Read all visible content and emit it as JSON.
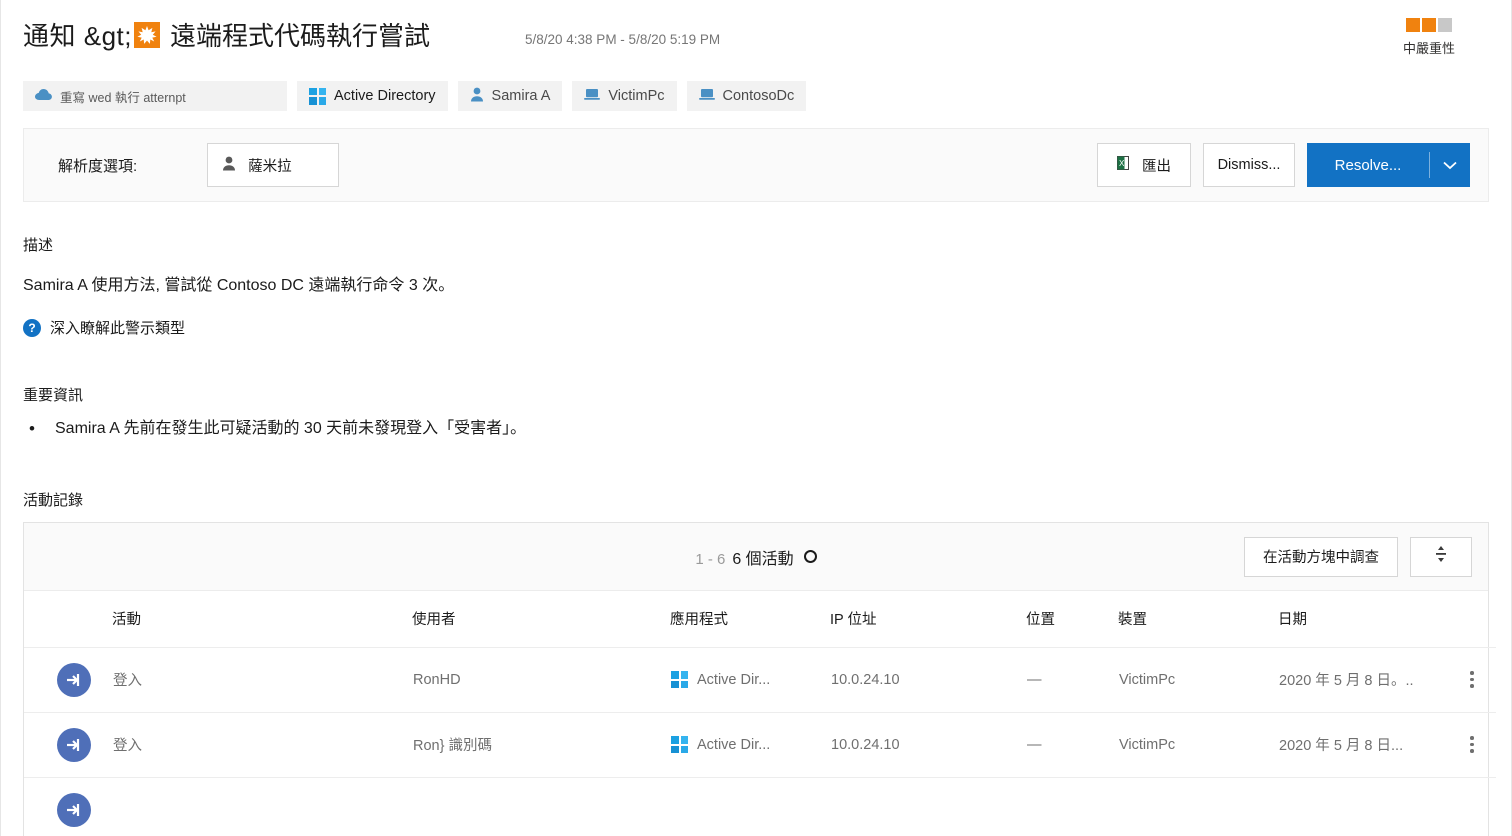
{
  "header": {
    "breadcrumb_prefix": "通知 &gt;",
    "title": "遠端程式代碼執行嘗試",
    "time_range": "5/8/20 4:38 PM - 5/8/20 5:19 PM",
    "severity_label": "中嚴重性",
    "severity_color": "#f0820f",
    "severity_filled": 2,
    "severity_total": 3,
    "alert_icon": "alert-starburst-icon"
  },
  "entities": [
    {
      "label": "重寫 wed 執行 atternpt",
      "icon": "alert-cloud-icon",
      "wide": true
    },
    {
      "label": "Active Directory",
      "icon": "windows-logo-icon",
      "wide": false
    },
    {
      "label": "Samira A",
      "icon": "user-icon",
      "wide": false
    },
    {
      "label": "VictimPc",
      "icon": "device-icon",
      "wide": false
    },
    {
      "label": "ContosoDc",
      "icon": "device-icon",
      "wide": false
    }
  ],
  "action_bar": {
    "resolution_label": "解析度選項:",
    "assignee": "薩米拉",
    "assignee_icon": "user-icon",
    "export_label": "匯出",
    "export_icon": "excel-export-icon",
    "dismiss_label": "Dismiss...",
    "resolve_label": "Resolve...",
    "resolve_caret_icon": "chevron-down-icon",
    "primary_color": "#1272c4"
  },
  "description": {
    "section_title": "描述",
    "body": "Samira A 使用方法, 嘗試從 Contoso DC 遠端執行命令 3 次。",
    "learn_more": "深入瞭解此警示類型",
    "learn_more_icon": "question-circle-icon"
  },
  "important": {
    "section_title": "重要資訊",
    "items": [
      "Samira A 先前在發生此可疑活動的 30 天前未發現登入「受害者」。"
    ]
  },
  "activity_log": {
    "section_title": "活動記錄",
    "range_text": "1 - 6",
    "count_text": "6 個活動",
    "refresh_icon": "refresh-circle-icon",
    "investigate_label": "在活動方塊中調查",
    "column_options_icon": "column-options-icon",
    "columns": [
      "",
      "活動",
      "使用者",
      "應用程式",
      "IP 位址",
      "位置",
      "裝置",
      "日期",
      ""
    ],
    "rows": [
      {
        "icon": "sign-in-icon",
        "activity": "登入",
        "user": "RonHD",
        "app": "Active Dir...",
        "app_icon": "windows-logo-icon",
        "ip": "10.0.24.10",
        "location": "—",
        "device": "VictimPc",
        "date": "2020 年 5 月 8 日。..",
        "more_icon": "kebab-menu-icon"
      },
      {
        "icon": "sign-in-icon",
        "activity": "登入",
        "user": "Ron} 識別碼",
        "app": "Active Dir...",
        "app_icon": "windows-logo-icon",
        "ip": "10.0.24.10",
        "location": "—",
        "device": "VictimPc",
        "date": "2020 年 5 月 8 日...",
        "more_icon": "kebab-menu-icon"
      }
    ]
  }
}
